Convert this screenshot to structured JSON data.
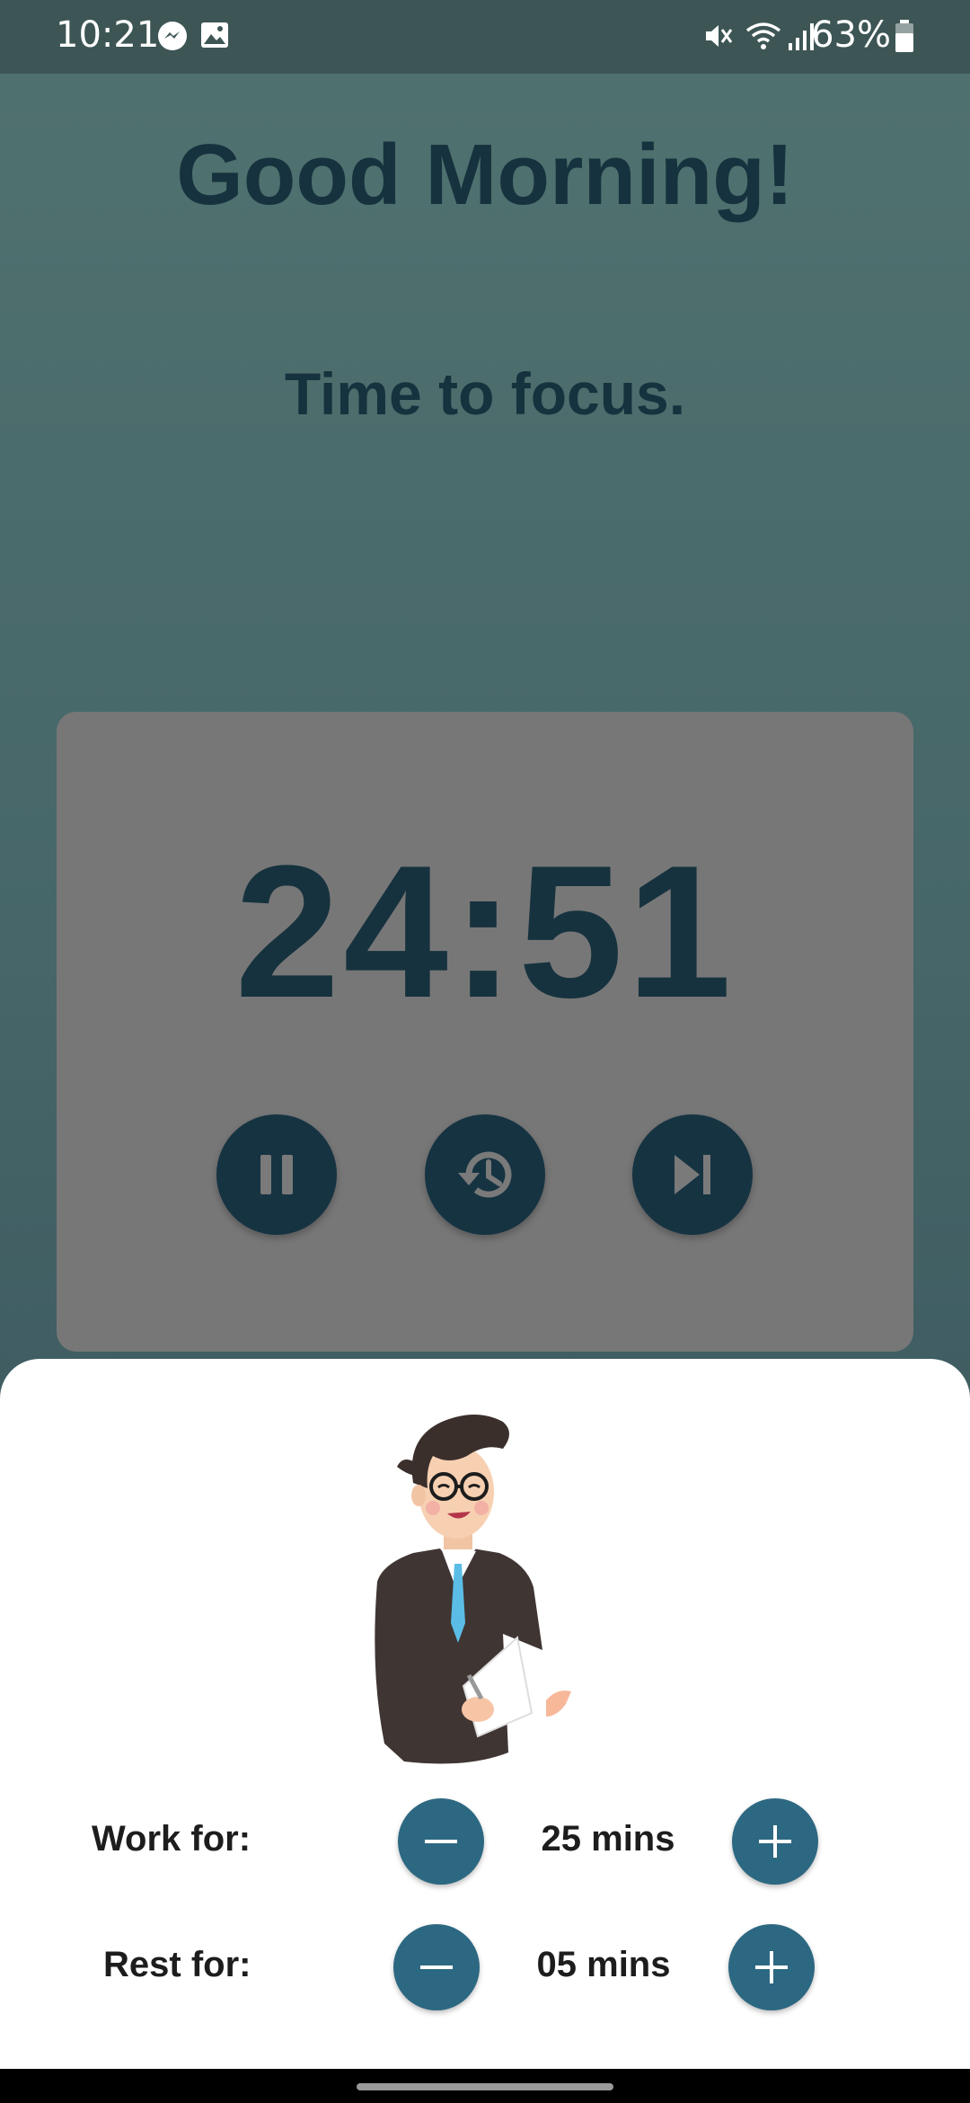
{
  "status_bar": {
    "time": "10:21",
    "battery": "63%"
  },
  "greeting": "Good Morning!",
  "subtitle": "Time to focus.",
  "timer": {
    "display": "24:51"
  },
  "controls": {
    "pause_icon": "pause-icon",
    "reset_icon": "history-icon",
    "skip_icon": "skip-next-icon"
  },
  "settings": {
    "work": {
      "label": "Work for:",
      "value": "25 mins"
    },
    "rest": {
      "label": "Rest for:",
      "value": "05 mins"
    }
  },
  "colors": {
    "primary_dark": "#163342",
    "accent": "#2d6882",
    "card": "#777777"
  }
}
